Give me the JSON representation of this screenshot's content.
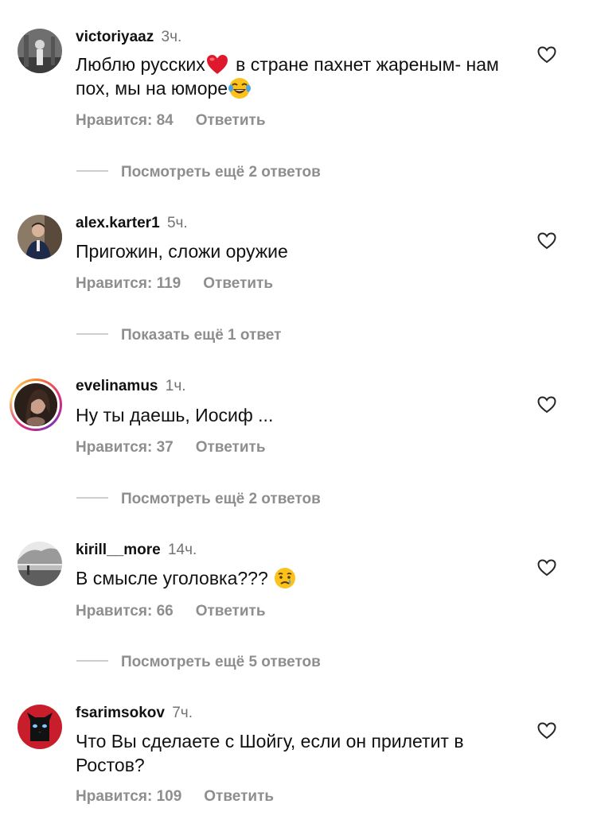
{
  "comments": [
    {
      "username": "victoriyaaz",
      "time": "3ч.",
      "text_part1": "Люблю русских",
      "text_part2": " в стране пахнет жареным- нам пох, мы на юморе",
      "likes": "Нравится: 84",
      "reply": "Ответить",
      "more": "Посмотреть ещё 2 ответов"
    },
    {
      "username": "alex.karter1",
      "time": "5ч.",
      "text": "Пригожин, сложи оружие",
      "likes": "Нравится: 119",
      "reply": "Ответить",
      "more": "Показать ещё 1 ответ"
    },
    {
      "username": "evelinamus",
      "time": "1ч.",
      "text": "Ну ты даешь, Иосиф ...",
      "likes": "Нравится: 37",
      "reply": "Ответить",
      "more": "Посмотреть ещё 2 ответов"
    },
    {
      "username": "kirill__more",
      "time": "14ч.",
      "text": "В смысле уголовка??? ",
      "likes": "Нравится: 66",
      "reply": "Ответить",
      "more": "Посмотреть ещё 5 ответов"
    },
    {
      "username": "fsarimsokov",
      "time": "7ч.",
      "text": "Что Вы сделаете с Шойгу, если он прилетит в Ростов?",
      "likes": "Нравится: 109",
      "reply": "Ответить"
    }
  ],
  "icons": {
    "like": "heart-outline-icon",
    "emoji_heart": "red-heart-emoji-icon",
    "emoji_laugh": "tears-of-joy-emoji-icon",
    "emoji_cry": "crying-face-emoji-icon"
  },
  "colors": {
    "secondary_text": "#8e8e8e",
    "timestamp": "#737373",
    "story_ring": "#dd2a7b"
  }
}
